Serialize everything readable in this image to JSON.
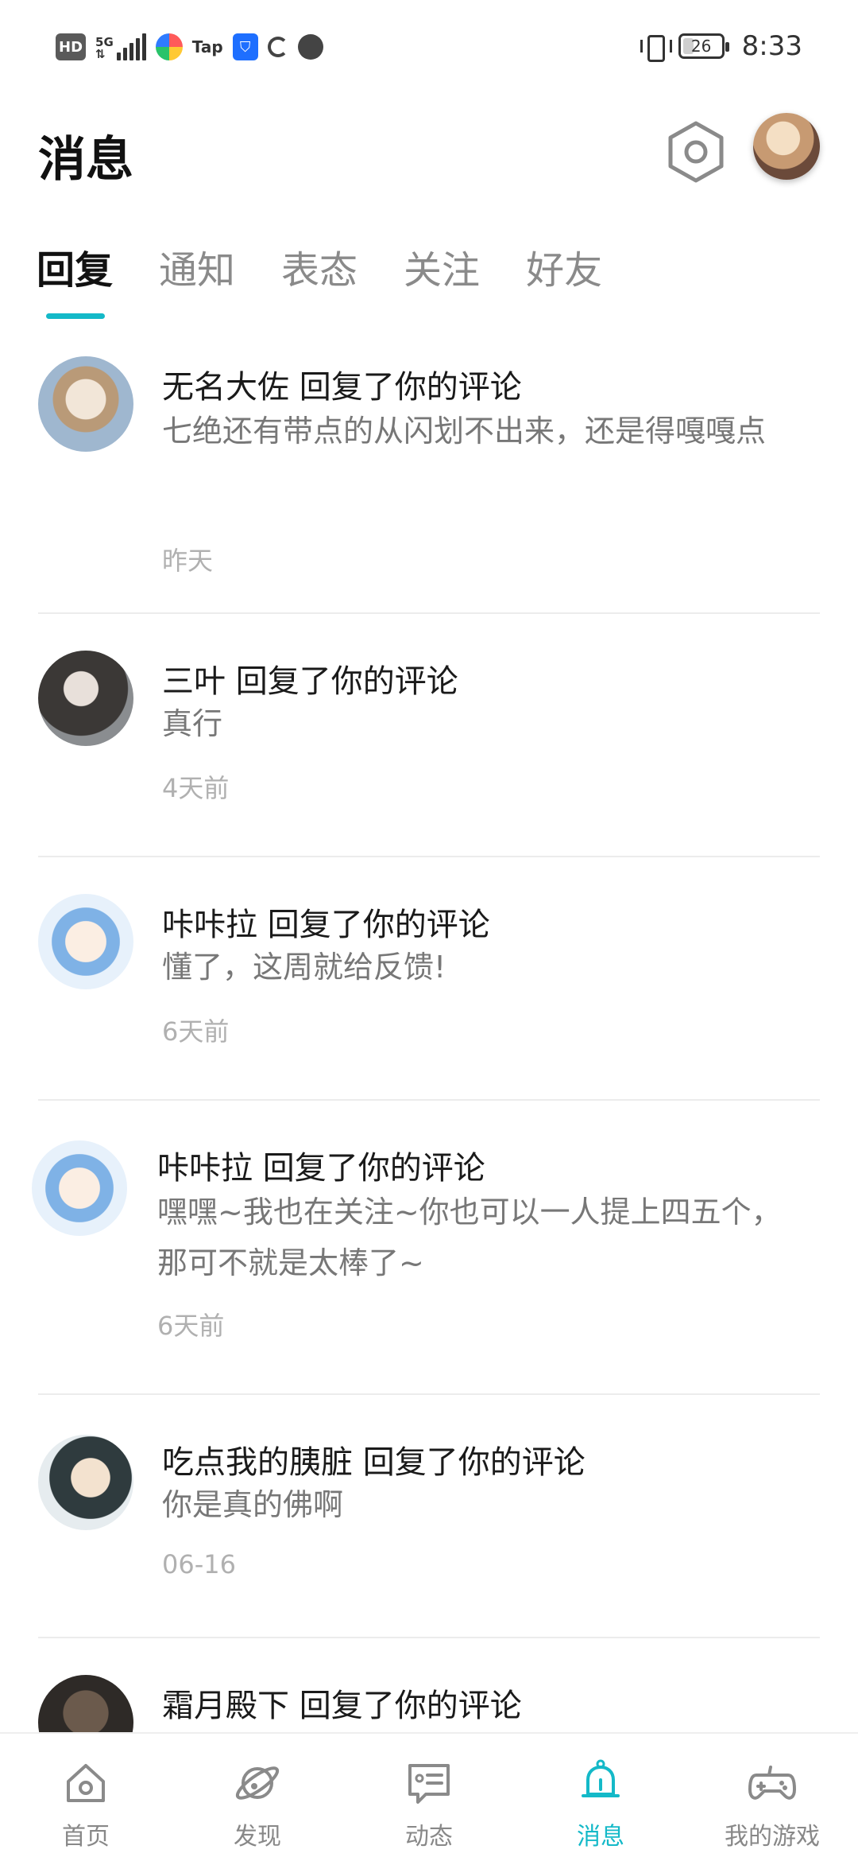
{
  "status_bar": {
    "hd_label": "HD",
    "network_label": "5G",
    "tap_label": "Tap",
    "battery_level": "26",
    "time": "8:33"
  },
  "header": {
    "title": "消息"
  },
  "tabs": [
    {
      "label": "回复",
      "active": true
    },
    {
      "label": "通知"
    },
    {
      "label": "表态"
    },
    {
      "label": "关注"
    },
    {
      "label": "好友"
    }
  ],
  "messages": [
    {
      "title": "无名大佐 回复了你的评论",
      "body": "七绝还有带点的从闪划不出来，还是得嘎嘎点",
      "time": "昨天"
    },
    {
      "title": "三叶 回复了你的评论",
      "body": "真行",
      "time": "4天前"
    },
    {
      "title": "咔咔拉 回复了你的评论",
      "body": "懂了，这周就给反馈!",
      "time": "6天前"
    },
    {
      "title": "咔咔拉 回复了你的评论",
      "body": "嘿嘿~我也在关注~你也可以一人提上四五个，那可不就是太棒了~",
      "time": "6天前"
    },
    {
      "title": "吃点我的胰脏 回复了你的评论",
      "body": "你是真的佛啊",
      "time": "06-16"
    },
    {
      "title": "霜月殿下 回复了你的评论"
    }
  ],
  "bottom_nav": [
    {
      "label": "首页",
      "icon": "home-icon"
    },
    {
      "label": "发现",
      "icon": "planet-icon"
    },
    {
      "label": "动态",
      "icon": "feed-icon"
    },
    {
      "label": "消息",
      "icon": "bell-icon",
      "active": true
    },
    {
      "label": "我的游戏",
      "icon": "gamepad-icon"
    }
  ],
  "colors": {
    "accent": "#14b9c8",
    "text_primary": "#111111",
    "text_secondary": "#777777",
    "text_muted": "#b0b0b0"
  }
}
